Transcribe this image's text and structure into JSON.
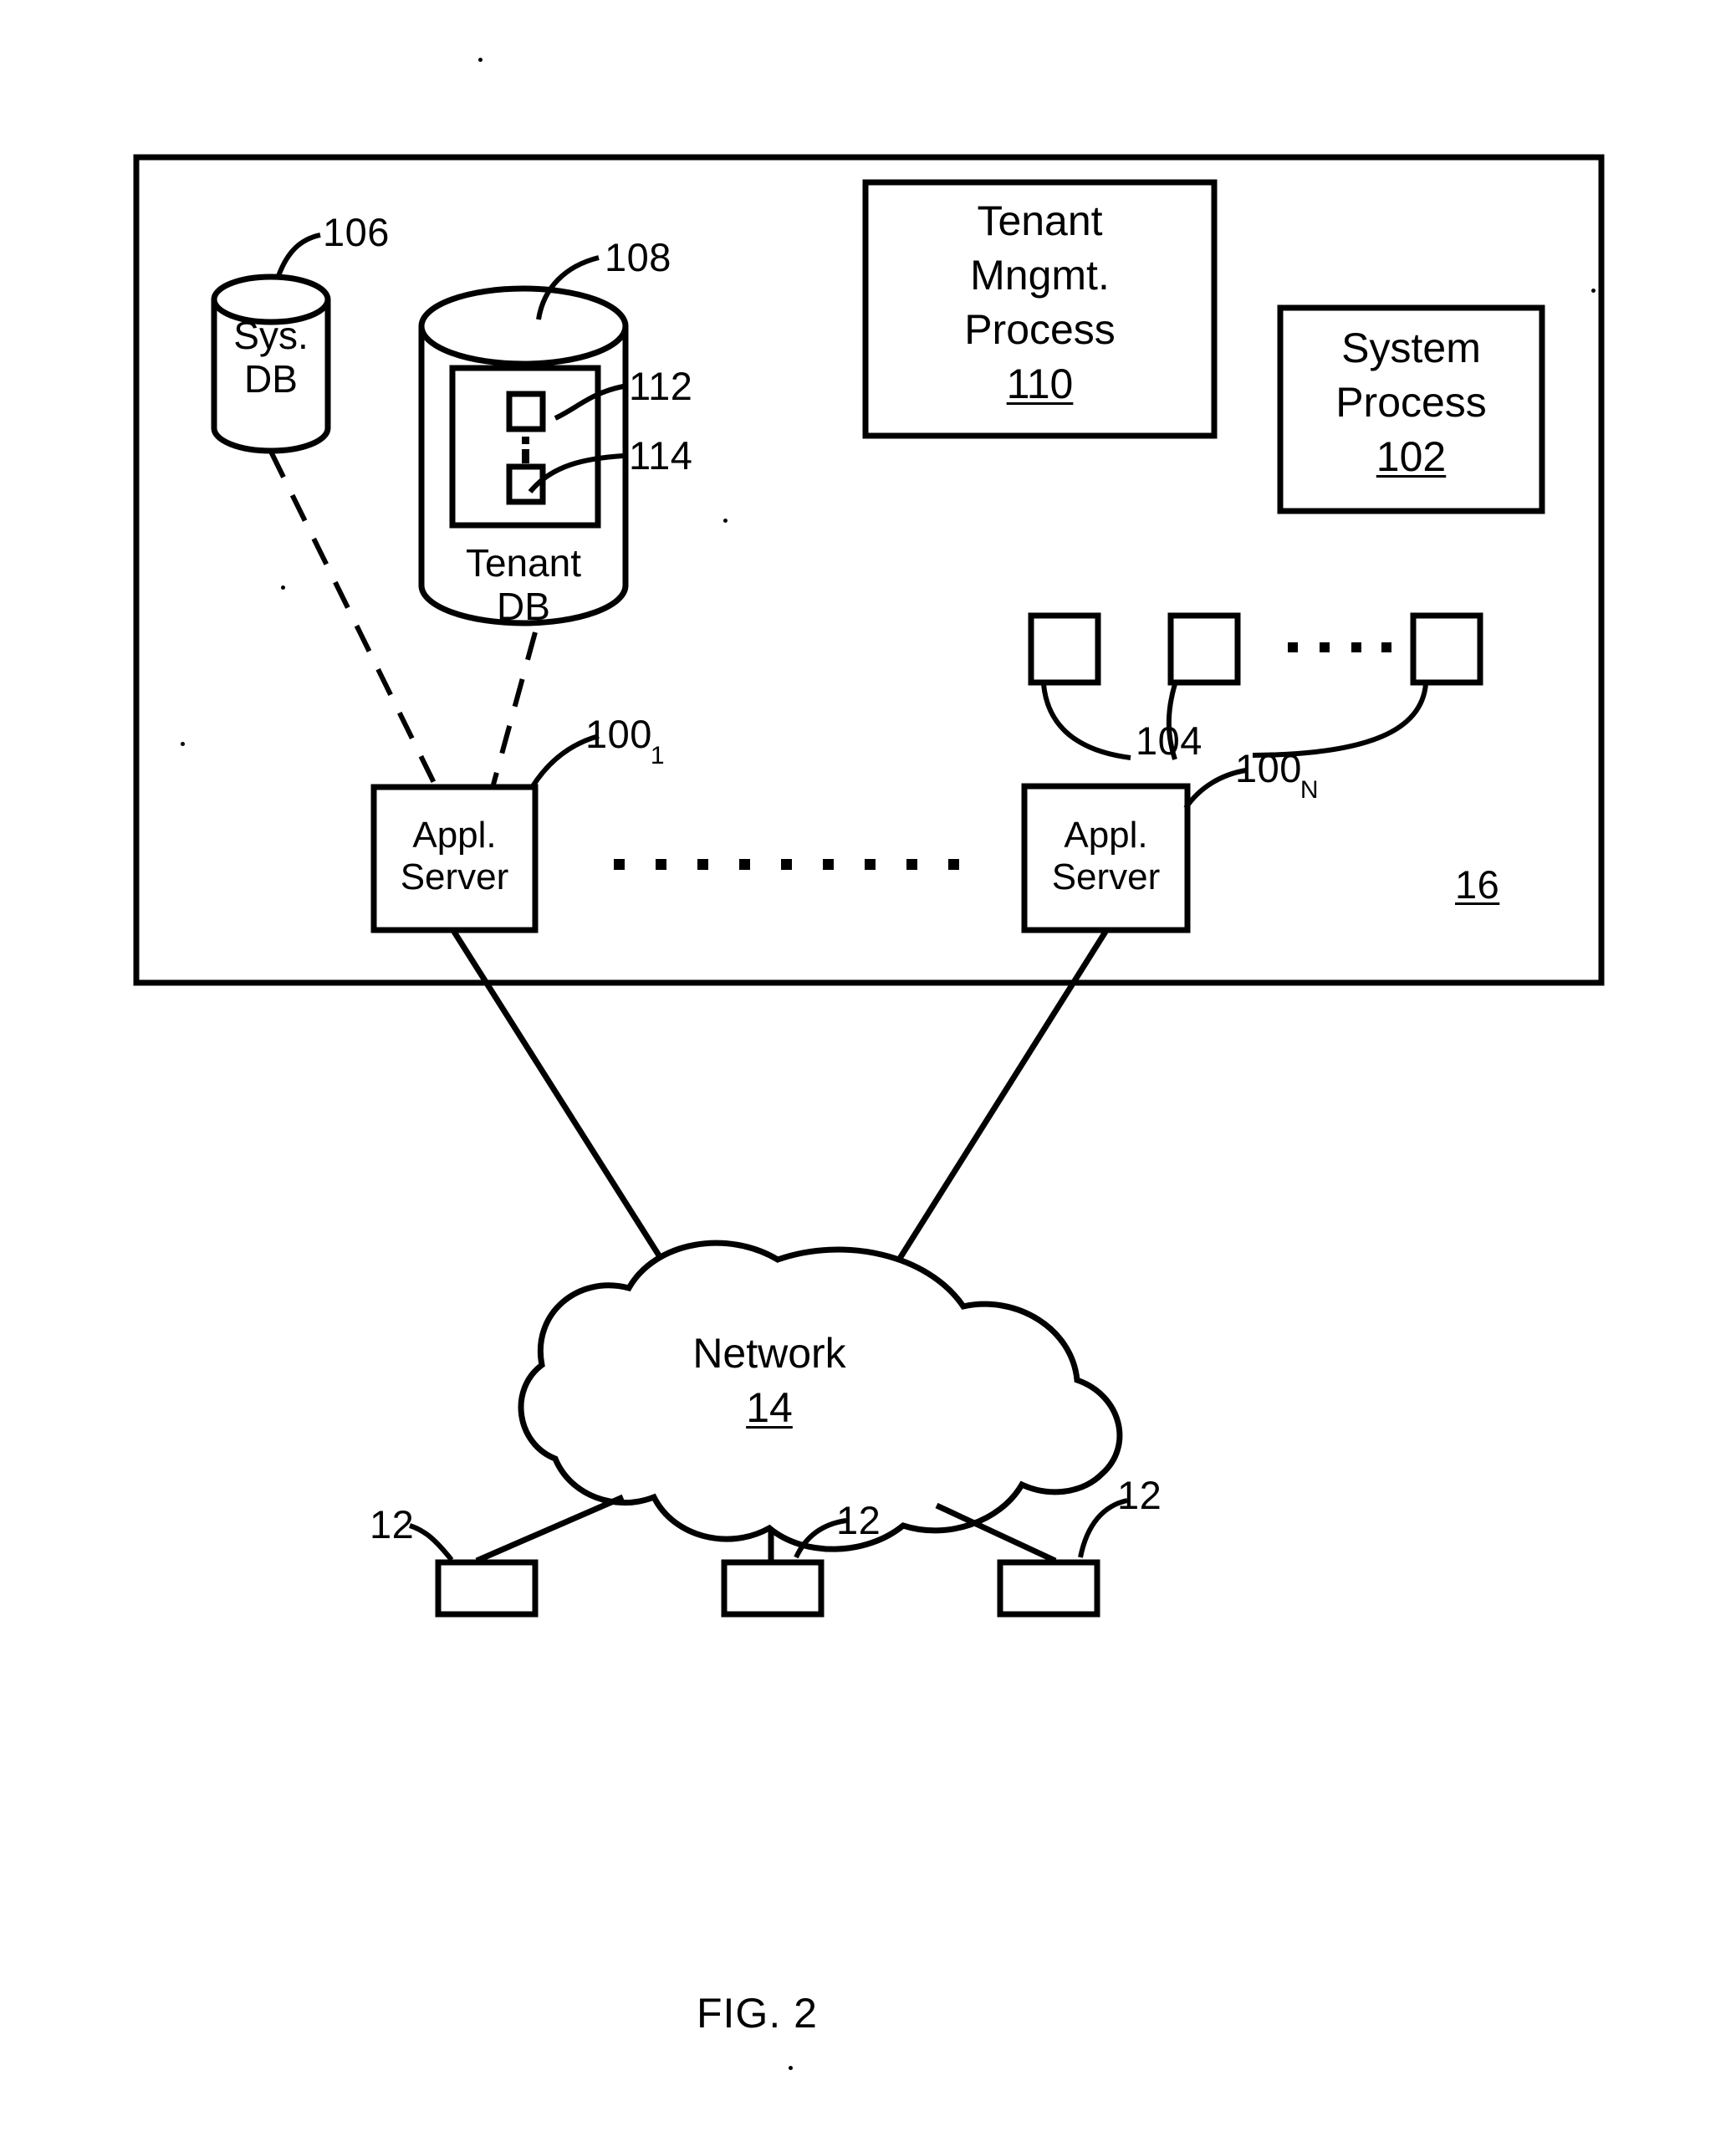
{
  "figure": {
    "caption": "FIG. 2",
    "system_ref": "16"
  },
  "system_box": {
    "ref_label": "16",
    "databases": [
      {
        "name": "sys-db",
        "line1": "Sys.",
        "line2": "DB",
        "ref": "106"
      },
      {
        "name": "tenant-db",
        "line1": "Tenant",
        "line2": "DB",
        "ref": "108"
      }
    ],
    "tenant_storage": {
      "area_ref": "112",
      "item_ref": "114",
      "ellipsis": "⋮"
    },
    "processes": [
      {
        "name": "tenant-management-process",
        "line1": "Tenant",
        "line2": "Mngmt.",
        "line3": "Process",
        "ref": "110"
      },
      {
        "name": "system-process",
        "line1": "System",
        "line2": "Process",
        "ref": "102"
      }
    ],
    "process_space": {
      "ref": "104",
      "count": 3,
      "ellipsis": ". . . ."
    },
    "app_servers": [
      {
        "name": "app-server-first",
        "line1": "Appl.",
        "line2": "Server",
        "ref_base": "100",
        "ref_sub": "1"
      },
      {
        "name": "app-server-last",
        "line1": "Appl.",
        "line2": "Server",
        "ref_base": "100",
        "ref_sub": "N"
      }
    ],
    "server_ellipsis": ". . . . . . . . ."
  },
  "network": {
    "label": "Network",
    "ref": "14"
  },
  "clients": [
    {
      "name": "client-left",
      "ref": "12"
    },
    {
      "name": "client-center",
      "ref": "12"
    },
    {
      "name": "client-right",
      "ref": "12"
    }
  ],
  "colors": {
    "ink": "#000000",
    "paper": "#ffffff"
  }
}
